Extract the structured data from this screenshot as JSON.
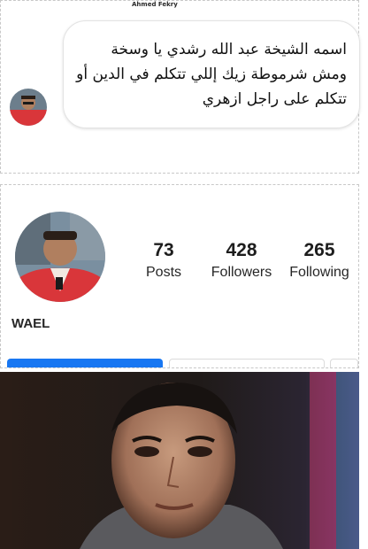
{
  "comment": {
    "author_tag": "Ahmed Fekry",
    "text": "اسمه الشيخة عبد الله رشدي يا وسخة ومش شرموطة زيك إللي تتكلم في الدين أو تتكلم على راجل ازهري"
  },
  "profile": {
    "username": "WAEL",
    "posts_count": "73",
    "posts_label": "Posts",
    "followers_count": "428",
    "followers_label": "Followers",
    "following_count": "265",
    "following_label": "Following"
  },
  "colors": {
    "follow_button": "#1877f2",
    "jacket": "#d9363a"
  }
}
